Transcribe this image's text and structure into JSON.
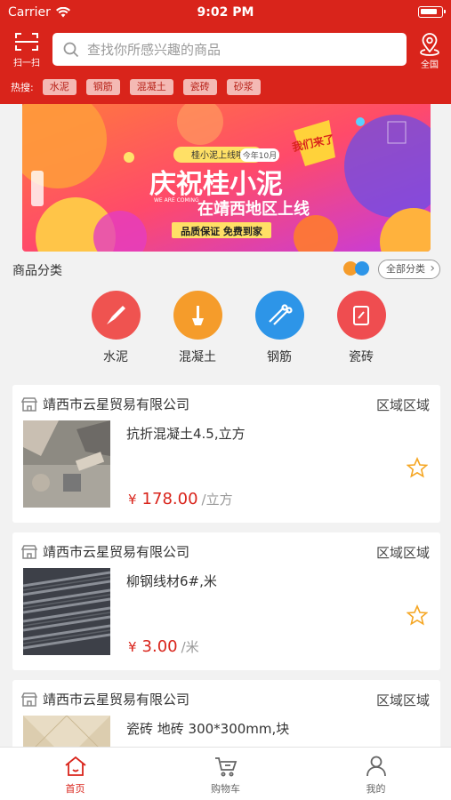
{
  "status_bar": {
    "carrier": "Carrier",
    "time": "9:02 PM"
  },
  "header": {
    "scan_label": "扫一扫",
    "search_placeholder": "查找你所感兴趣的商品",
    "location_label": "全国",
    "hot_label": "热搜:",
    "hot_tags": [
      "水泥",
      "钢筋",
      "混凝土",
      "瓷砖",
      "砂浆"
    ]
  },
  "banner": {
    "tag": "桂小泥上线啦",
    "tag_date": "今年10月",
    "headline": "庆祝桂小泥",
    "subhead": "在靖西地区上线",
    "slogan": "品质保证 免费到家",
    "small_en": "WE ARE COMING",
    "burst": "我们来了"
  },
  "categories": {
    "title": "商品分类",
    "all_label": "全部分类",
    "items": [
      {
        "name": "水泥",
        "color": "#ef5350"
      },
      {
        "name": "混凝土",
        "color": "#f59c2b"
      },
      {
        "name": "钢筋",
        "color": "#2d95e8"
      },
      {
        "name": "瓷砖",
        "color": "#ef4d50"
      }
    ]
  },
  "products": [
    {
      "shop": "靖西市云星贸易有限公司",
      "region": "区域区域",
      "name": "抗折混凝土4.5,立方",
      "currency": "¥",
      "price": "178.00",
      "unit": "/立方"
    },
    {
      "shop": "靖西市云星贸易有限公司",
      "region": "区域区域",
      "name": "柳钢线材6#,米",
      "currency": "¥",
      "price": "3.00",
      "unit": "/米"
    },
    {
      "shop": "靖西市云星贸易有限公司",
      "region": "区域区域",
      "name": "瓷砖 地砖 300*300mm,块"
    }
  ],
  "tabbar": {
    "tabs": [
      {
        "label": "首页",
        "active": true
      },
      {
        "label": "购物车",
        "active": false
      },
      {
        "label": "我的",
        "active": false
      }
    ]
  },
  "colors": {
    "brand": "#d9241b",
    "star": "#f5a623"
  }
}
